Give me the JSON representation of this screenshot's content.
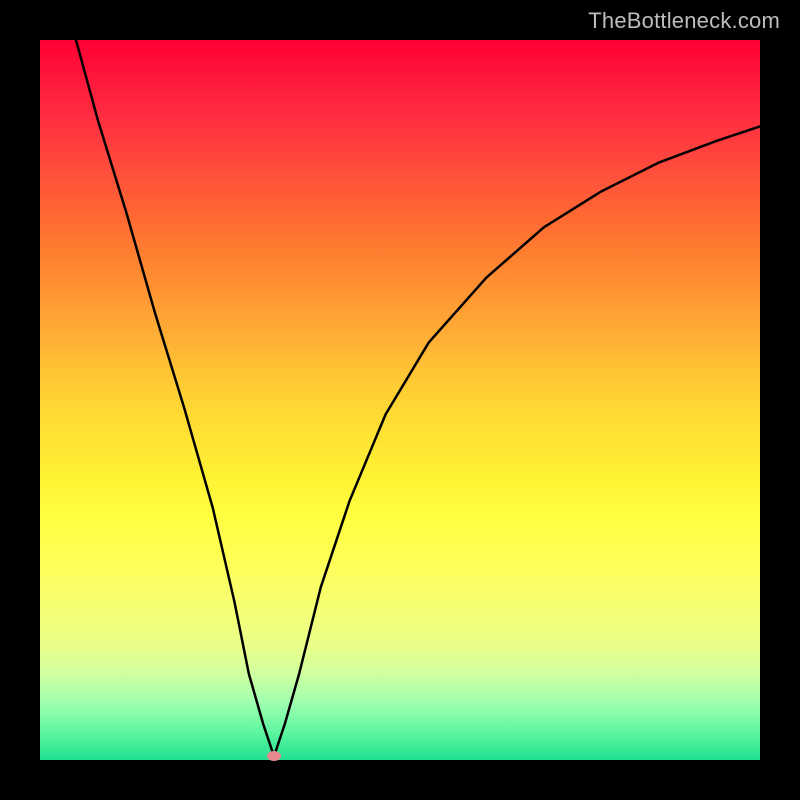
{
  "watermark": "TheBottleneck.com",
  "chart_data": {
    "type": "line",
    "title": "",
    "xlabel": "",
    "ylabel": "",
    "x_range": [
      0,
      100
    ],
    "y_range": [
      0,
      100
    ],
    "background_gradient": {
      "top": "#ff0033",
      "bottom": "#20e090"
    },
    "series": [
      {
        "name": "curve",
        "x": [
          5,
          8,
          12,
          16,
          20,
          24,
          27,
          29,
          31,
          32.5,
          34,
          36,
          39,
          43,
          48,
          54,
          62,
          70,
          78,
          86,
          94,
          100
        ],
        "y": [
          100,
          89,
          76,
          62,
          49,
          35,
          22,
          12,
          5,
          0.5,
          5,
          12,
          24,
          36,
          48,
          58,
          67,
          74,
          79,
          83,
          86,
          88
        ],
        "note": "V-shaped dip; minimum near x≈32.5 at bottom, rising steeply left side to top-left, asymptotically rising on right"
      }
    ],
    "marker": {
      "name": "min-marker",
      "x": 32.5,
      "y": 0.5,
      "color": "#e88890"
    }
  }
}
